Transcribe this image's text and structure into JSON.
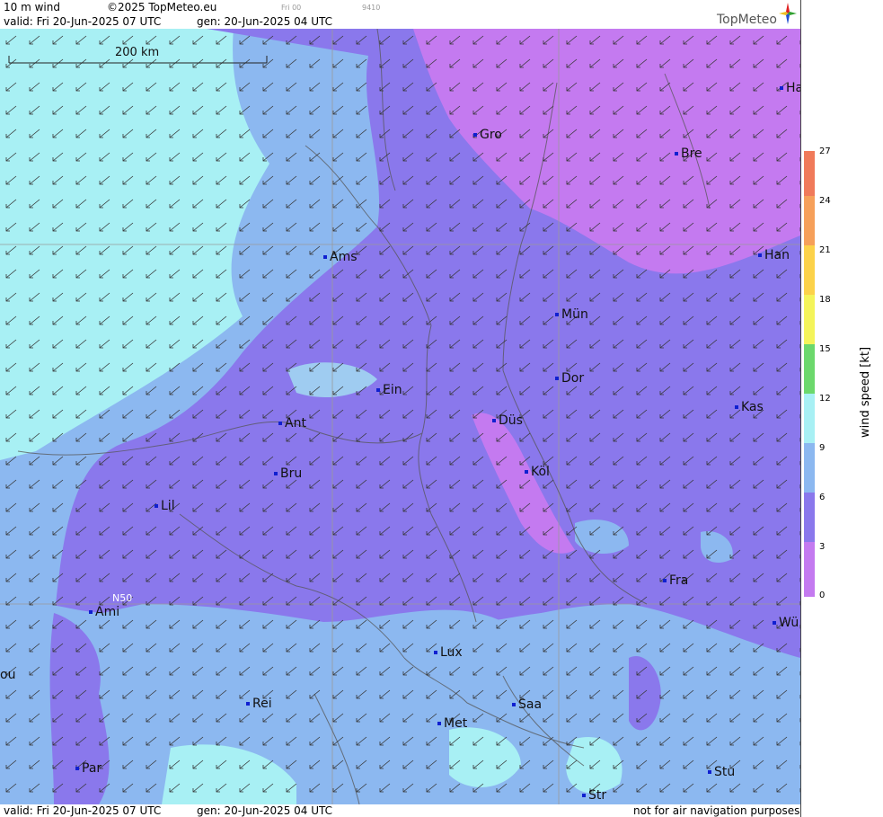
{
  "header": {
    "product": "10 m wind",
    "copyright": "©2025 TopMeteo.eu",
    "valid": "valid:  Fri  20-Jun-2025  07 UTC",
    "gen": "gen: 20-Jun-2025  04 UTC",
    "small_time": "Fri 00",
    "small_code": "9410",
    "logo": "TopMeteo"
  },
  "map": {
    "scale_label": "200 km",
    "lat_label": "N50",
    "cities": [
      {
        "name": "Ha"
      },
      {
        "name": "Gro"
      },
      {
        "name": "Bre"
      },
      {
        "name": "Ams"
      },
      {
        "name": "Han"
      },
      {
        "name": "Mün"
      },
      {
        "name": "Ein"
      },
      {
        "name": "Dor"
      },
      {
        "name": "Kas"
      },
      {
        "name": "Ant"
      },
      {
        "name": "Düs"
      },
      {
        "name": "Bru"
      },
      {
        "name": "Köl"
      },
      {
        "name": "Lil"
      },
      {
        "name": "Fra"
      },
      {
        "name": "Ami"
      },
      {
        "name": "Wü"
      },
      {
        "name": "ou"
      },
      {
        "name": "Lux"
      },
      {
        "name": "Rei"
      },
      {
        "name": "Saa"
      },
      {
        "name": "Met"
      },
      {
        "name": "Par"
      },
      {
        "name": "Stu"
      },
      {
        "name": "Str"
      }
    ]
  },
  "footer": {
    "valid": "valid:  Fri  20-Jun-2025  07 UTC",
    "gen": "gen: 20-Jun-2025  04 UTC",
    "note": "not for air navigation purposes"
  },
  "legend": {
    "unit_label": "wind  speed  [kt]",
    "ticks": [
      "27",
      "24",
      "21",
      "18",
      "15",
      "12",
      "9",
      "6",
      "3",
      "0"
    ],
    "colors": [
      "#f07a5a",
      "#f6a05a",
      "#fcd24a",
      "#f4f45a",
      "#b4e85a",
      "#6cd86c",
      "#80e4e8",
      "#a8f0f4",
      "#8cb8f0",
      "#8a78ec",
      "#c47af0"
    ]
  },
  "palette": {
    "violet": "#c47af0",
    "purple": "#8a78ec",
    "blue": "#8cb8f0",
    "cyan": "#a8f0f4"
  }
}
